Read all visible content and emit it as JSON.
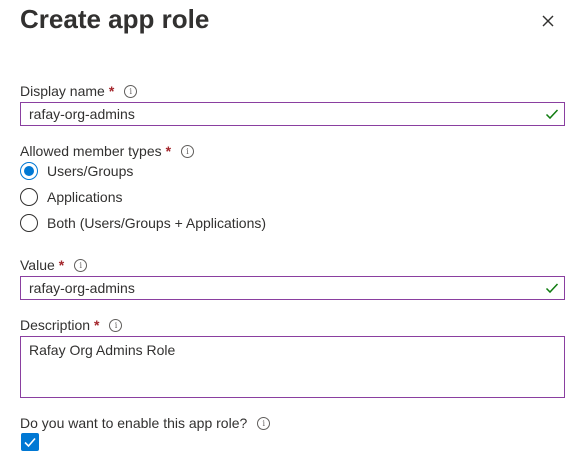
{
  "panel": {
    "title": "Create app role",
    "close_icon": "close-icon"
  },
  "display_name": {
    "label": "Display name",
    "required_mark": "*",
    "info_icon": "info-icon",
    "value": "rafay-org-admins",
    "valid_icon": "checkmark-icon"
  },
  "member_types": {
    "label": "Allowed member types",
    "required_mark": "*",
    "info_icon": "info-icon",
    "options": [
      {
        "label": "Users/Groups",
        "selected": true
      },
      {
        "label": "Applications",
        "selected": false
      },
      {
        "label": "Both (Users/Groups + Applications)",
        "selected": false
      }
    ]
  },
  "value_field": {
    "label": "Value",
    "required_mark": "*",
    "info_icon": "info-icon",
    "value": "rafay-org-admins",
    "valid_icon": "checkmark-icon"
  },
  "description": {
    "label": "Description",
    "required_mark": "*",
    "info_icon": "info-icon",
    "value": "Rafay Org Admins Role"
  },
  "enable": {
    "label": "Do you want to enable this app role?",
    "info_icon": "info-icon",
    "checked": true
  },
  "colors": {
    "accent": "#0078d4",
    "valid_border": "#8a3fa0",
    "valid_check": "#107c10",
    "required": "#a4262c",
    "text": "#323130"
  }
}
